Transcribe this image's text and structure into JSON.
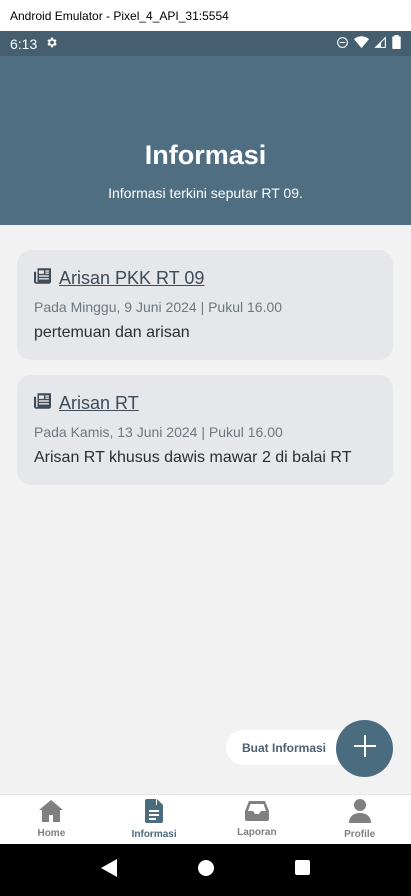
{
  "window": {
    "title": "Android Emulator - Pixel_4_API_31:5554"
  },
  "status_bar": {
    "time": "6:13"
  },
  "header": {
    "title": "Informasi",
    "subtitle": "Informasi terkini seputar RT 09."
  },
  "cards": [
    {
      "title": "Arisan PKK RT 09",
      "meta": "Pada Minggu, 9 Juni 2024 | Pukul 16.00",
      "description": "pertemuan dan arisan"
    },
    {
      "title": "Arisan RT",
      "meta": "Pada Kamis, 13 Juni 2024 | Pukul 16.00",
      "description": "Arisan RT khusus dawis mawar 2 di balai RT"
    }
  ],
  "fab": {
    "label": "Buat Informasi",
    "icon": "plus-icon"
  },
  "bottom_nav": [
    {
      "label": "Home",
      "icon": "home-icon",
      "active": false
    },
    {
      "label": "Informasi",
      "icon": "document-icon",
      "active": true
    },
    {
      "label": "Laporan",
      "icon": "inbox-icon",
      "active": false
    },
    {
      "label": "Profile",
      "icon": "person-icon",
      "active": false
    }
  ],
  "colors": {
    "header": "#4f6e82",
    "status_bar": "#455f70",
    "accent": "#4b6b7e",
    "card_bg": "#e6e7ea",
    "content_bg": "#f2f2f2"
  }
}
